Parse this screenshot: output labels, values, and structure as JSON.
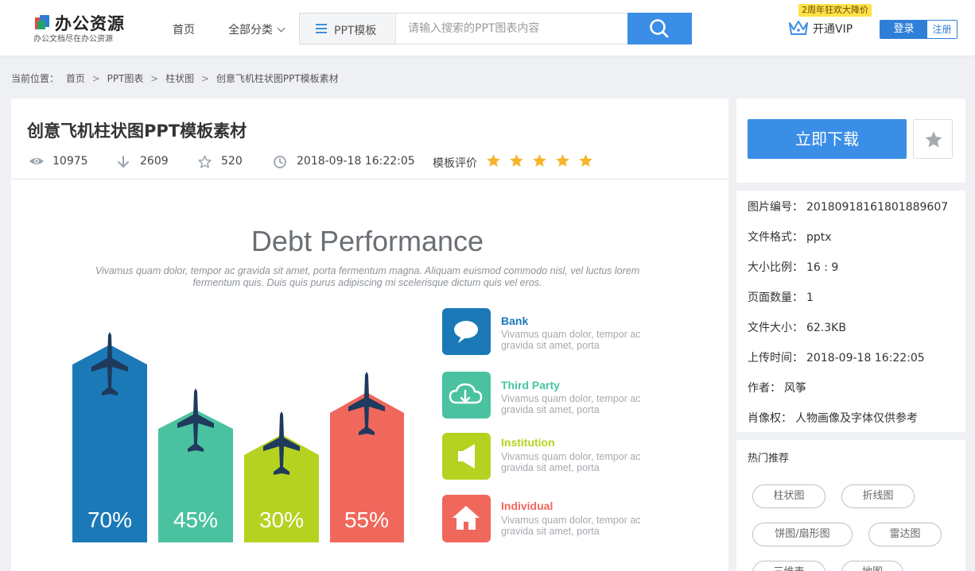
{
  "header": {
    "logo_title": "办公资源",
    "logo_subtitle": "办公文档尽在办公资源",
    "nav_home": "首页",
    "nav_all": "全部分类",
    "search_category": "PPT模板",
    "search_placeholder": "请输入搜索的PPT图表内容",
    "vip_badge": "2周年狂欢大降价",
    "vip_label": "开通VIP",
    "login": "登录",
    "register": "注册"
  },
  "breadcrumb": {
    "prefix": "当前位置：",
    "items": [
      "首页",
      "PPT图表",
      "柱状图",
      "创意飞机柱状图PPT模板素材"
    ],
    "separator": ">"
  },
  "detail": {
    "title": "创意飞机柱状图PPT模板素材",
    "views": "10975",
    "downloads": "2609",
    "favorites": "520",
    "date": "2018-09-18 16:22:05",
    "rating_label": "模板评价",
    "rating_stars": 5
  },
  "preview": {
    "title": "Debt Performance",
    "subtitle_line1": "Vivamus quam dolor, tempor ac gravida sit amet, porta fermentum magna. Aliquam euismod commodo nisl, vel luctus lorem",
    "subtitle_line2": "fermentum quis. Duis quis purus adipiscing mi scelerisque dictum quis vel eros.",
    "bars": [
      {
        "label": "70%",
        "value": 70,
        "color": "#1b79b8"
      },
      {
        "label": "45%",
        "value": 45,
        "color": "#4ac2a0"
      },
      {
        "label": "30%",
        "value": 30,
        "color": "#b5d221"
      },
      {
        "label": "55%",
        "value": 55,
        "color": "#f0675c"
      }
    ],
    "plane_color": "#1f3a5c",
    "legend": [
      {
        "name": "Bank",
        "color": "#1b79b8",
        "icon": "speech-bubble-icon",
        "line1": "Vivamus quam dolor, tempor ac",
        "line2": "gravida sit amet, porta"
      },
      {
        "name": "Third Party",
        "color": "#4ac2a0",
        "icon": "cloud-download-icon",
        "line1": "Vivamus quam dolor, tempor ac",
        "line2": "gravida sit amet, porta"
      },
      {
        "name": "Institution",
        "color": "#b5d221",
        "icon": "megaphone-icon",
        "line1": "Vivamus quam dolor, tempor ac",
        "line2": "gravida sit amet, porta"
      },
      {
        "name": "Individual",
        "color": "#f0675c",
        "icon": "home-icon",
        "line1": "Vivamus quam dolor, tempor ac",
        "line2": "gravida sit amet, porta"
      }
    ]
  },
  "sidebar": {
    "download": "立即下载",
    "info": [
      {
        "key": "图片编号：",
        "value": "20180918161801889607"
      },
      {
        "key": "文件格式：",
        "value": "pptx"
      },
      {
        "key": "大小比例：",
        "value": "16 : 9"
      },
      {
        "key": "页面数量：",
        "value": "1"
      },
      {
        "key": "文件大小：",
        "value": "62.3KB"
      },
      {
        "key": "上传时间：",
        "value": "2018-09-18 16:22:05"
      },
      {
        "key": "作者：",
        "value": "风筝"
      },
      {
        "key": "肖像权：",
        "value": "人物画像及字体仅供参考"
      }
    ],
    "hot_title": "热门推荐",
    "tags": [
      "柱状图",
      "折线图",
      "饼图/扇形图",
      "雷达图",
      "三维表",
      "地图"
    ]
  },
  "colors": {
    "accent": "#3a8ee6",
    "star": "#f7b52c",
    "vip_badge_bg": "#ffe24a"
  }
}
